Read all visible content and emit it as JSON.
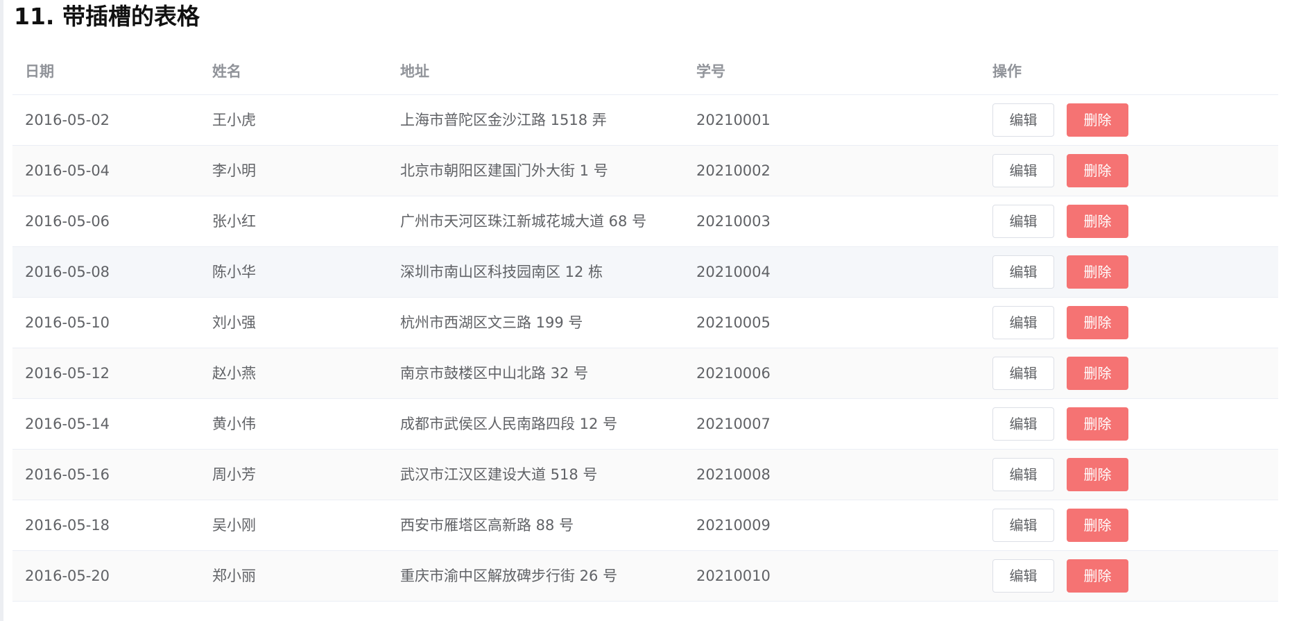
{
  "section": {
    "title": "11. 带插槽的表格"
  },
  "table": {
    "headers": {
      "date": "日期",
      "name": "姓名",
      "address": "地址",
      "student_id": "学号",
      "actions": "操作"
    },
    "rows": [
      {
        "date": "2016-05-02",
        "name": "王小虎",
        "address": "上海市普陀区金沙江路 1518 弄",
        "student_id": "20210001",
        "edit_label": "编辑",
        "delete_label": "删除"
      },
      {
        "date": "2016-05-04",
        "name": "李小明",
        "address": "北京市朝阳区建国门外大街 1 号",
        "student_id": "20210002",
        "edit_label": "编辑",
        "delete_label": "删除"
      },
      {
        "date": "2016-05-06",
        "name": "张小红",
        "address": "广州市天河区珠江新城花城大道 68 号",
        "student_id": "20210003",
        "edit_label": "编辑",
        "delete_label": "删除"
      },
      {
        "date": "2016-05-08",
        "name": "陈小华",
        "address": "深圳市南山区科技园南区 12 栋",
        "student_id": "20210004",
        "edit_label": "编辑",
        "delete_label": "删除"
      },
      {
        "date": "2016-05-10",
        "name": "刘小强",
        "address": "杭州市西湖区文三路 199 号",
        "student_id": "20210005",
        "edit_label": "编辑",
        "delete_label": "删除"
      },
      {
        "date": "2016-05-12",
        "name": "赵小燕",
        "address": "南京市鼓楼区中山北路 32 号",
        "student_id": "20210006",
        "edit_label": "编辑",
        "delete_label": "删除"
      },
      {
        "date": "2016-05-14",
        "name": "黄小伟",
        "address": "成都市武侯区人民南路四段 12 号",
        "student_id": "20210007",
        "edit_label": "编辑",
        "delete_label": "删除"
      },
      {
        "date": "2016-05-16",
        "name": "周小芳",
        "address": "武汉市江汉区建设大道 518 号",
        "student_id": "20210008",
        "edit_label": "编辑",
        "delete_label": "删除"
      },
      {
        "date": "2016-05-18",
        "name": "吴小刚",
        "address": "西安市雁塔区高新路 88 号",
        "student_id": "20210009",
        "edit_label": "编辑",
        "delete_label": "删除"
      },
      {
        "date": "2016-05-20",
        "name": "郑小丽",
        "address": "重庆市渝中区解放碑步行街 26 号",
        "student_id": "20210010",
        "edit_label": "编辑",
        "delete_label": "删除"
      }
    ]
  },
  "colors": {
    "header_text": "#909399",
    "body_text": "#606266",
    "stripe_background": "#fafafa",
    "highlight_background": "#f5f7fa",
    "danger": "#f56c6c",
    "border": "#ebeef5"
  }
}
